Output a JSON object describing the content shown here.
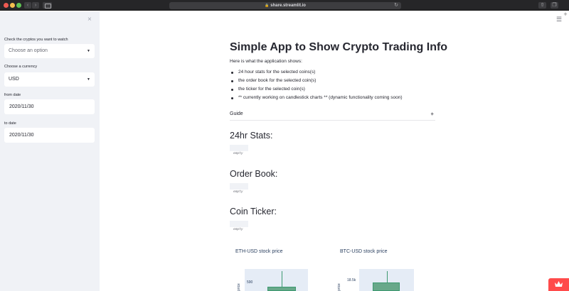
{
  "browser": {
    "url": "share.streamlit.io",
    "icons": [
      "back-icon",
      "forward-icon",
      "sidebar-icon",
      "lock-icon",
      "reload-icon",
      "share-icon",
      "tabs-icon",
      "plus-icon"
    ]
  },
  "sidebar": {
    "close_icon": "×",
    "crypto_label": "Check the cryptos you want to watch",
    "crypto_placeholder": "Choose an option",
    "currency_label": "Choose a currency",
    "currency_value": "USD",
    "from_label": "from date",
    "from_value": "2020/11/30",
    "to_label": "to date",
    "to_value": "2020/11/30"
  },
  "main": {
    "title": "Simple App to Show Crypto Trading Info",
    "intro": "Here is what the application shows:",
    "bullets": [
      "24 hour stats for the selected coins(s)",
      "the order book for the selected coin(s)",
      "the ticker for the selected coin(s)",
      "** currently working on candlestick charts ** (dynamic functionality coming soon)"
    ],
    "guide_label": "Guide",
    "guide_toggle": "+",
    "stats_heading": "24hr Stats:",
    "orderbook_heading": "Order Book:",
    "ticker_heading": "Coin Ticker:",
    "empty_text": "empty"
  },
  "chart_data": [
    {
      "type": "candlestick",
      "title": "ETH-USD stock price",
      "ylabel": "price",
      "y_ticks": [
        "590"
      ]
    },
    {
      "type": "candlestick",
      "title": "BTC-USD stock price",
      "ylabel": "price",
      "y_ticks": [
        "18.5k"
      ]
    }
  ],
  "colors": {
    "sidebar_bg": "#f0f2f6",
    "plot_bg": "#e5ecf6",
    "increasing": "#3d9970",
    "brand": "#ff4b4b"
  }
}
